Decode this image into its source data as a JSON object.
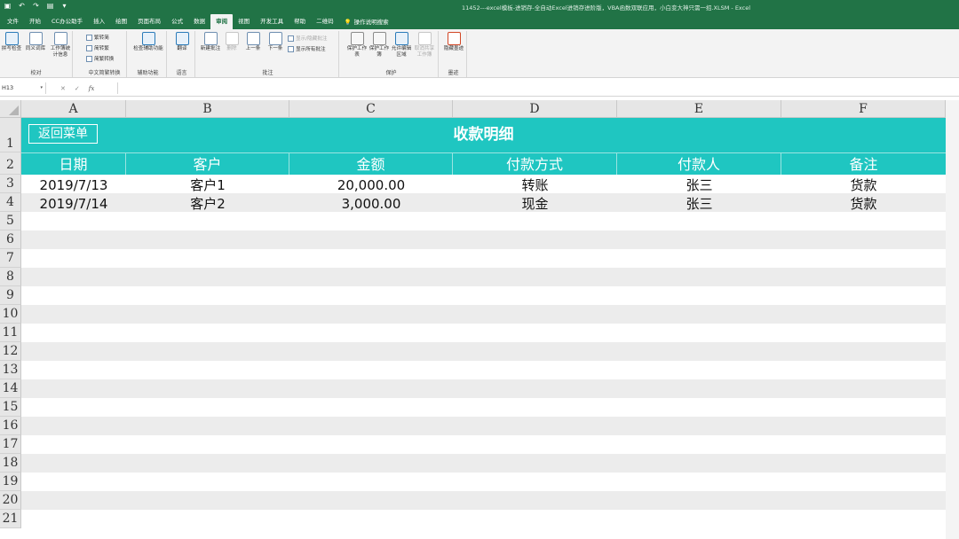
{
  "window": {
    "title": "11452---excel模板-进销存-全自动Excel进销存进阶版，VBA函数双联应用，小白变大神只需一招.XLSM  -  Excel"
  },
  "tabs": [
    "文件",
    "开始",
    "CC办公助手",
    "插入",
    "绘图",
    "页面布局",
    "公式",
    "数据",
    "审阅",
    "视图",
    "开发工具",
    "帮助",
    "二维码",
    "操作说明搜索"
  ],
  "active_tab": "审阅",
  "ribbon": {
    "groups": {
      "proofing": "校对",
      "chinese": "中文简繁转换",
      "accessibility": "辅助功能",
      "language": "语言",
      "comments": "批注",
      "protect": "保护",
      "ink": "墨迹"
    },
    "buttons": {
      "spelling": "拼写检查",
      "thesaurus": "同义词库",
      "stats": "工作簿统计信息",
      "to_simplified": "繁转简",
      "to_traditional": "简转繁",
      "convert": "简繁转换",
      "check_access": "检查辅助功能",
      "translate": "翻译",
      "new_comment": "新建批注",
      "delete": "删除",
      "prev": "上一条",
      "next": "下一条",
      "show_hide": "显示/隐藏批注",
      "show_all": "显示所有批注",
      "protect_sheet": "保护工作表",
      "protect_book": "保护工作簿",
      "allow_edit": "允许编辑区域",
      "unshare": "取消共享工作簿",
      "hide_ink": "隐藏墨迹"
    }
  },
  "formula_bar": {
    "name_box": "H13",
    "fx": "fx",
    "cancel": "✕",
    "enter": "✓",
    "value": ""
  },
  "sheet": {
    "columns": [
      "A",
      "B",
      "C",
      "D",
      "E",
      "F"
    ],
    "rows": [
      "1",
      "2",
      "3",
      "4",
      "5",
      "6",
      "7",
      "8",
      "9",
      "10",
      "11",
      "12",
      "13",
      "14",
      "15",
      "16",
      "17",
      "18",
      "19",
      "20",
      "21"
    ],
    "back_button": "返回菜单",
    "title": "收款明细",
    "headers": [
      "日期",
      "客户",
      "金额",
      "付款方式",
      "付款人",
      "备注"
    ],
    "records": [
      [
        "2019/7/13",
        "客户1",
        "20,000.00",
        "转账",
        "张三",
        "货款"
      ],
      [
        "2019/7/14",
        "客户2",
        "3,000.00",
        "现金",
        "张三",
        "货款"
      ]
    ]
  },
  "colors": {
    "excel_green": "#217346",
    "header_teal": "#1fc6c1",
    "band_grey": "#ececec"
  }
}
